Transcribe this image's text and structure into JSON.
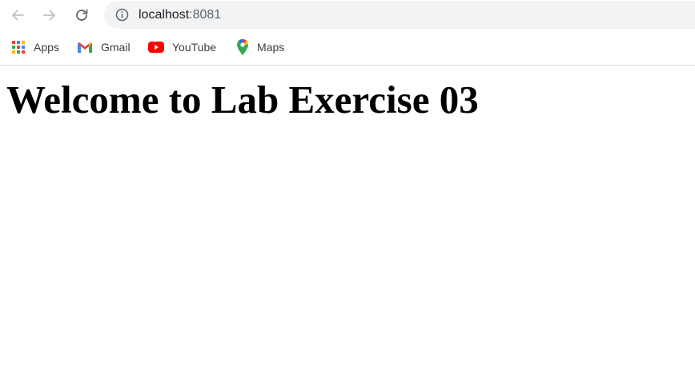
{
  "browser": {
    "url_host": "localhost",
    "url_port": ":8081"
  },
  "bookmarks": [
    {
      "label": "Apps",
      "icon": "apps-grid-icon"
    },
    {
      "label": "Gmail",
      "icon": "gmail-icon"
    },
    {
      "label": "YouTube",
      "icon": "youtube-icon"
    },
    {
      "label": "Maps",
      "icon": "maps-icon"
    }
  ],
  "page": {
    "heading": "Welcome to Lab Exercise 03"
  },
  "colors": {
    "omnibox_bg": "#f1f3f4",
    "youtube_red": "#ff0000",
    "gmail_red": "#ea4335"
  }
}
